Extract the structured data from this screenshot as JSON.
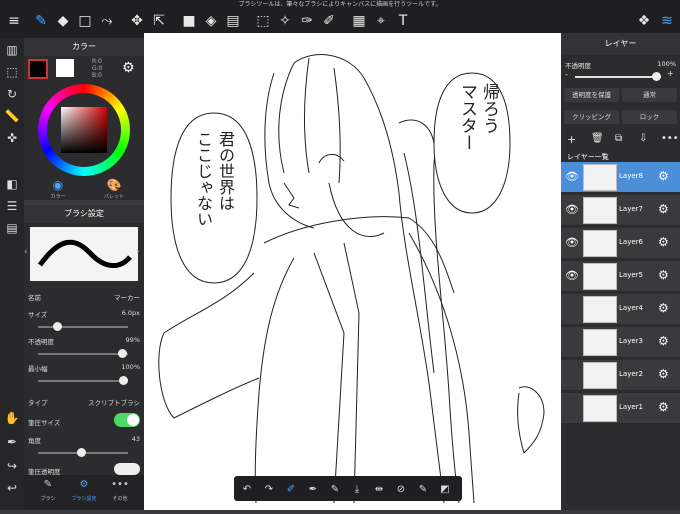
{
  "notice": "ブラシツールは、筆々なブラシによりキャンバスに描画を行うツールです。",
  "color_panel": {
    "title": "カラー",
    "r": "R:0",
    "g": "G:0",
    "b": "B:0",
    "tab_color": "カラー",
    "tab_palette": "パレット"
  },
  "brush_panel": {
    "title": "ブラシ設定",
    "name_label": "名前",
    "name_value": "マーカー",
    "size_label": "サイズ",
    "size_value": "6.0px",
    "size_level": 0.18,
    "opacity_label": "不透明度",
    "opacity_value": "99%",
    "opacity_level": 0.99,
    "minwidth_label": "最小幅",
    "minwidth_value": "100%",
    "minwidth_level": 1.0,
    "type_label": "タイプ",
    "type_value": "スクリプトブラシ",
    "pressure_size_label": "筆圧サイズ",
    "angle_label": "角度",
    "angle_value": "43",
    "angle_level": 0.48,
    "pressure_opacity_label": "筆圧透明度"
  },
  "bottom_tabs": [
    "ブラシ",
    "ブラシ設定",
    "その他"
  ],
  "layer_panel": {
    "title": "レイヤー",
    "opacity_label": "不透明度",
    "opacity_value": "100%",
    "protect_label": "透明度を保護",
    "blend_label": "通常",
    "clipping_label": "クリッピング",
    "lock_label": "ロック",
    "list_title": "レイヤー一覧",
    "layers": [
      "Layer8",
      "Layer7",
      "Layer6",
      "Layer5",
      "Layer4",
      "Layer3",
      "Layer2",
      "Layer1"
    ]
  },
  "bubbles": {
    "right_lines": [
      "帰ろう",
      "マスター"
    ],
    "left_lines": [
      "君の世界は",
      "ここじゃない"
    ]
  }
}
